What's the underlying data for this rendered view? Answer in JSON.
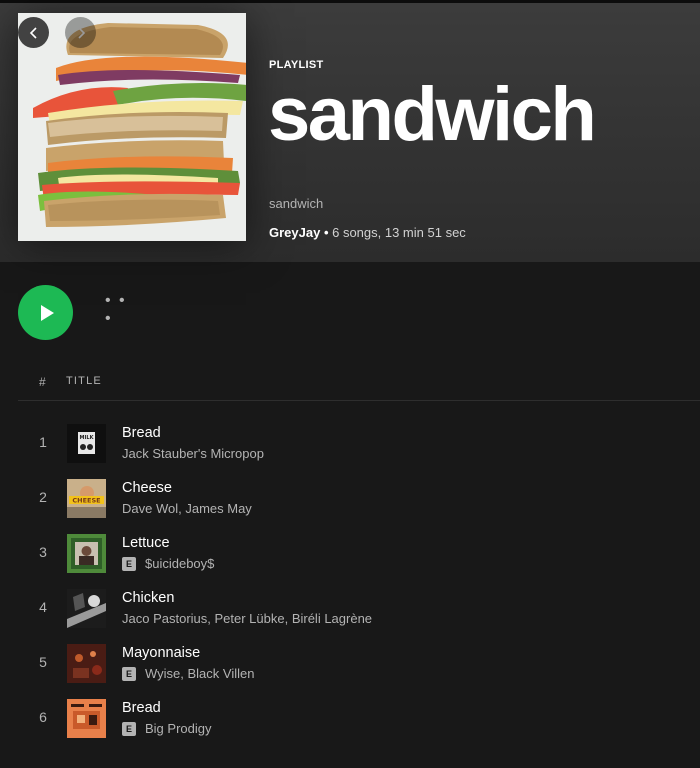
{
  "playlist": {
    "type_label": "PLAYLIST",
    "title": "sandwich",
    "description": "sandwich",
    "owner": "GreyJay",
    "separator": " • ",
    "stats": "6 songs, 13 min 51 sec"
  },
  "navigation": {
    "back_icon": "chevron-left-icon",
    "forward_icon": "chevron-right-icon"
  },
  "controls": {
    "play_icon": "play-icon",
    "more_label": "• • •"
  },
  "columns": {
    "number": "#",
    "title": "TITLE"
  },
  "accent_color": "#1db954",
  "tracks": [
    {
      "number": "1",
      "title": "Bread",
      "artists": "Jack Stauber's Micropop",
      "explicit": false
    },
    {
      "number": "2",
      "title": "Cheese",
      "artists": "Dave Wol, James May",
      "explicit": false
    },
    {
      "number": "3",
      "title": "Lettuce",
      "artists": "$uicideboy$",
      "explicit": true,
      "explicit_label": "E"
    },
    {
      "number": "4",
      "title": "Chicken",
      "artists": "Jaco Pastorius, Peter Lübke, Biréli Lagrène",
      "explicit": false
    },
    {
      "number": "5",
      "title": "Mayonnaise",
      "artists": "Wyise, Black Villen",
      "explicit": true,
      "explicit_label": "E"
    },
    {
      "number": "6",
      "title": "Bread",
      "artists": "Big Prodigy",
      "explicit": true,
      "explicit_label": "E"
    }
  ],
  "album_art": {
    "1": {
      "text": "MILK"
    },
    "2": {
      "text": "CHEESE"
    }
  }
}
